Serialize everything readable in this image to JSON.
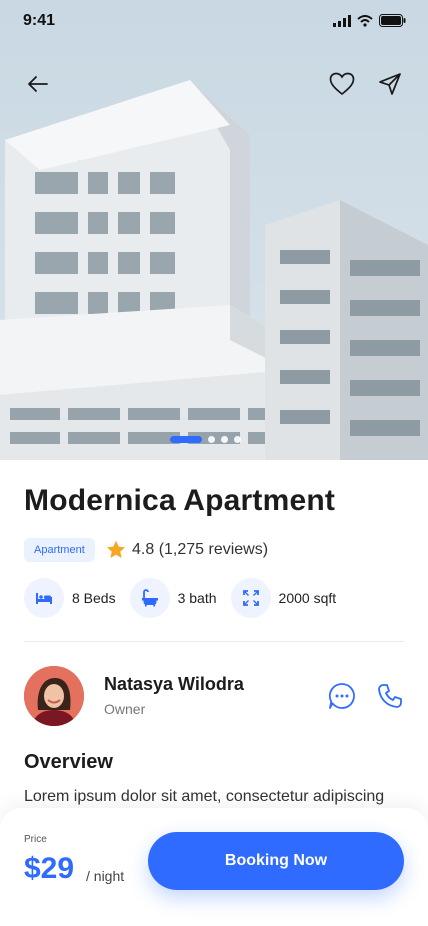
{
  "status_bar": {
    "time": "9:41"
  },
  "header": {
    "back_icon": "arrow-left-icon",
    "favorite_icon": "heart-icon",
    "share_icon": "send-icon"
  },
  "gallery": {
    "total_images": 4,
    "active_index": 0
  },
  "property": {
    "title": "Modernica Apartment",
    "type_chip": "Apartment",
    "rating": "4.8 (1,275 reviews)",
    "features": [
      {
        "icon": "bed-icon",
        "label": "8 Beds"
      },
      {
        "icon": "bath-icon",
        "label": "3 bath"
      },
      {
        "icon": "area-expand-icon",
        "label": "2000 sqft"
      }
    ]
  },
  "owner": {
    "name": "Natasya Wilodra",
    "role": "Owner",
    "chat_icon": "chat-bubble-icon",
    "call_icon": "phone-icon"
  },
  "overview": {
    "title": "Overview",
    "text": "Lorem ipsum dolor sit amet, consectetur adipiscing"
  },
  "booking": {
    "price_label": "Price",
    "price": "$29",
    "unit": "/ night",
    "button_label": "Booking Now"
  },
  "colors": {
    "accent": "#2f6bff",
    "chip_bg": "#eaf1ff",
    "star": "#f5a623"
  }
}
